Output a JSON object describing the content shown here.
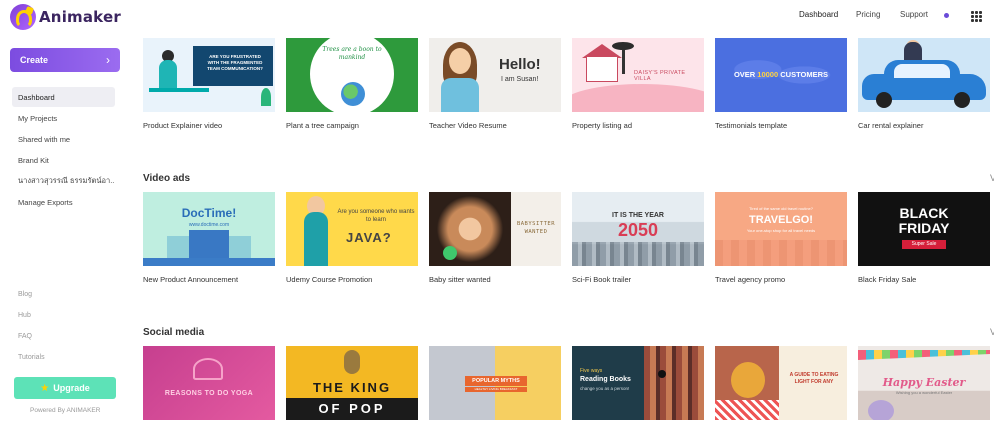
{
  "app": {
    "logo_text": "Animaker"
  },
  "header": {
    "nav": [
      "Dashboard",
      "Pricing",
      "Support"
    ]
  },
  "sidebar": {
    "create_label": "Create",
    "items": [
      {
        "label": "Dashboard",
        "active": true
      },
      {
        "label": "My Projects"
      },
      {
        "label": "Shared with me"
      },
      {
        "label": "Brand Kit"
      },
      {
        "label": "นางสาวสุวรรณี ธรรมรัตน์อา..."
      },
      {
        "label": "Manage Exports"
      }
    ],
    "links": [
      "Blog",
      "Hub",
      "FAQ",
      "Tutorials"
    ],
    "upgrade_label": "Upgrade",
    "powered_by": "Powered By ANIMAKER"
  },
  "sections": [
    {
      "title": "",
      "cards": [
        {
          "label": "Product Explainer video",
          "thumb_text": "ARE YOU FRUSTRATED WITH THE FRAGMENTED TEAM COMMUNICATION?"
        },
        {
          "label": "Plant a tree campaign",
          "thumb_text": "Trees are a boon to mankind"
        },
        {
          "label": "Teacher Video Resume",
          "thumb_title": "Hello!",
          "thumb_sub": "I am Susan!"
        },
        {
          "label": "Property listing ad",
          "thumb_text": "DAISY'S PRIVATE VILLA"
        },
        {
          "label": "Testimonials template",
          "thumb_pre": "OVER ",
          "thumb_num": "10000",
          "thumb_post": " CUSTOMERS"
        },
        {
          "label": "Car rental explainer"
        }
      ]
    },
    {
      "title": "Video ads",
      "cards": [
        {
          "label": "New Product Announcement",
          "thumb_title": "DocTime!",
          "thumb_sub": "www.doctime.com"
        },
        {
          "label": "Udemy Course Promotion",
          "thumb_q": "Are you someone who wants to learn",
          "thumb_title": "JAVA?"
        },
        {
          "label": "Baby sitter wanted",
          "thumb_text": "BABYSITTER WANTED"
        },
        {
          "label": "Sci-Fi Book trailer",
          "thumb_l1": "IT IS THE YEAR",
          "thumb_l2": "2050"
        },
        {
          "label": "Travel agency promo",
          "thumb_top": "Tired of the same old travel routine?",
          "thumb_title": "TRAVELGO!",
          "thumb_sub": "Your one-stop shop for all travel needs"
        },
        {
          "label": "Black Friday Sale",
          "thumb_l1": "BLACK",
          "thumb_l2": "FRIDAY",
          "thumb_tag": "Super Sale"
        }
      ]
    },
    {
      "title": "Social media",
      "cards": [
        {
          "label": "",
          "thumb_text": "REASONS TO DO YOGA"
        },
        {
          "label": "",
          "thumb_l1": "THE KING",
          "thumb_l2": "OF POP"
        },
        {
          "label": "",
          "thumb_tag": "POPULAR MYTHS",
          "thumb_sub": "HEALTHY LIVING BREAKFAST"
        },
        {
          "label": "",
          "thumb_t1": "Five ways",
          "thumb_t2": "Reading Books",
          "thumb_t3": "change you as a person!"
        },
        {
          "label": "",
          "thumb_text": "A GUIDE TO EATING LIGHT FOR ANY"
        },
        {
          "label": "",
          "thumb_title": "Happy Easter",
          "thumb_sub": "Wishing you a wonderful Easter"
        }
      ]
    }
  ],
  "colors": {
    "accent": "#7c4ce0",
    "upgrade": "#5de2b7",
    "status_dot": "#6a4bd8"
  }
}
